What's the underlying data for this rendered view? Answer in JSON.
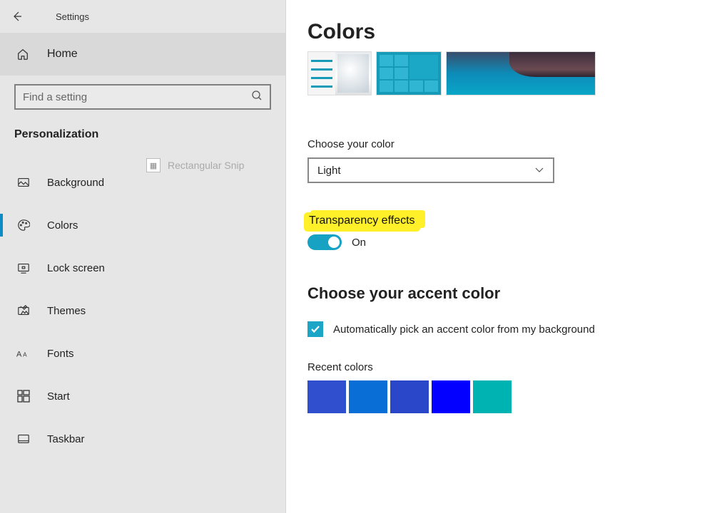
{
  "app": {
    "title": "Settings"
  },
  "sidebar": {
    "home": "Home",
    "search_placeholder": "Find a setting",
    "section": "Personalization",
    "watermark": "Rectangular Snip",
    "items": [
      {
        "label": "Background"
      },
      {
        "label": "Colors"
      },
      {
        "label": "Lock screen"
      },
      {
        "label": "Themes"
      },
      {
        "label": "Fonts"
      },
      {
        "label": "Start"
      },
      {
        "label": "Taskbar"
      }
    ]
  },
  "main": {
    "title": "Colors",
    "choose_color_label": "Choose your color",
    "choose_color_value": "Light",
    "transparency_label": "Transparency effects",
    "transparency_value": "On",
    "accent_heading": "Choose your accent color",
    "auto_accent_label": "Automatically pick an accent color from my background",
    "recent_label": "Recent colors",
    "recent_colors": [
      "#2f4fcf",
      "#0a6ed7",
      "#2a46c9",
      "#0400ff",
      "#00b3b3"
    ]
  }
}
